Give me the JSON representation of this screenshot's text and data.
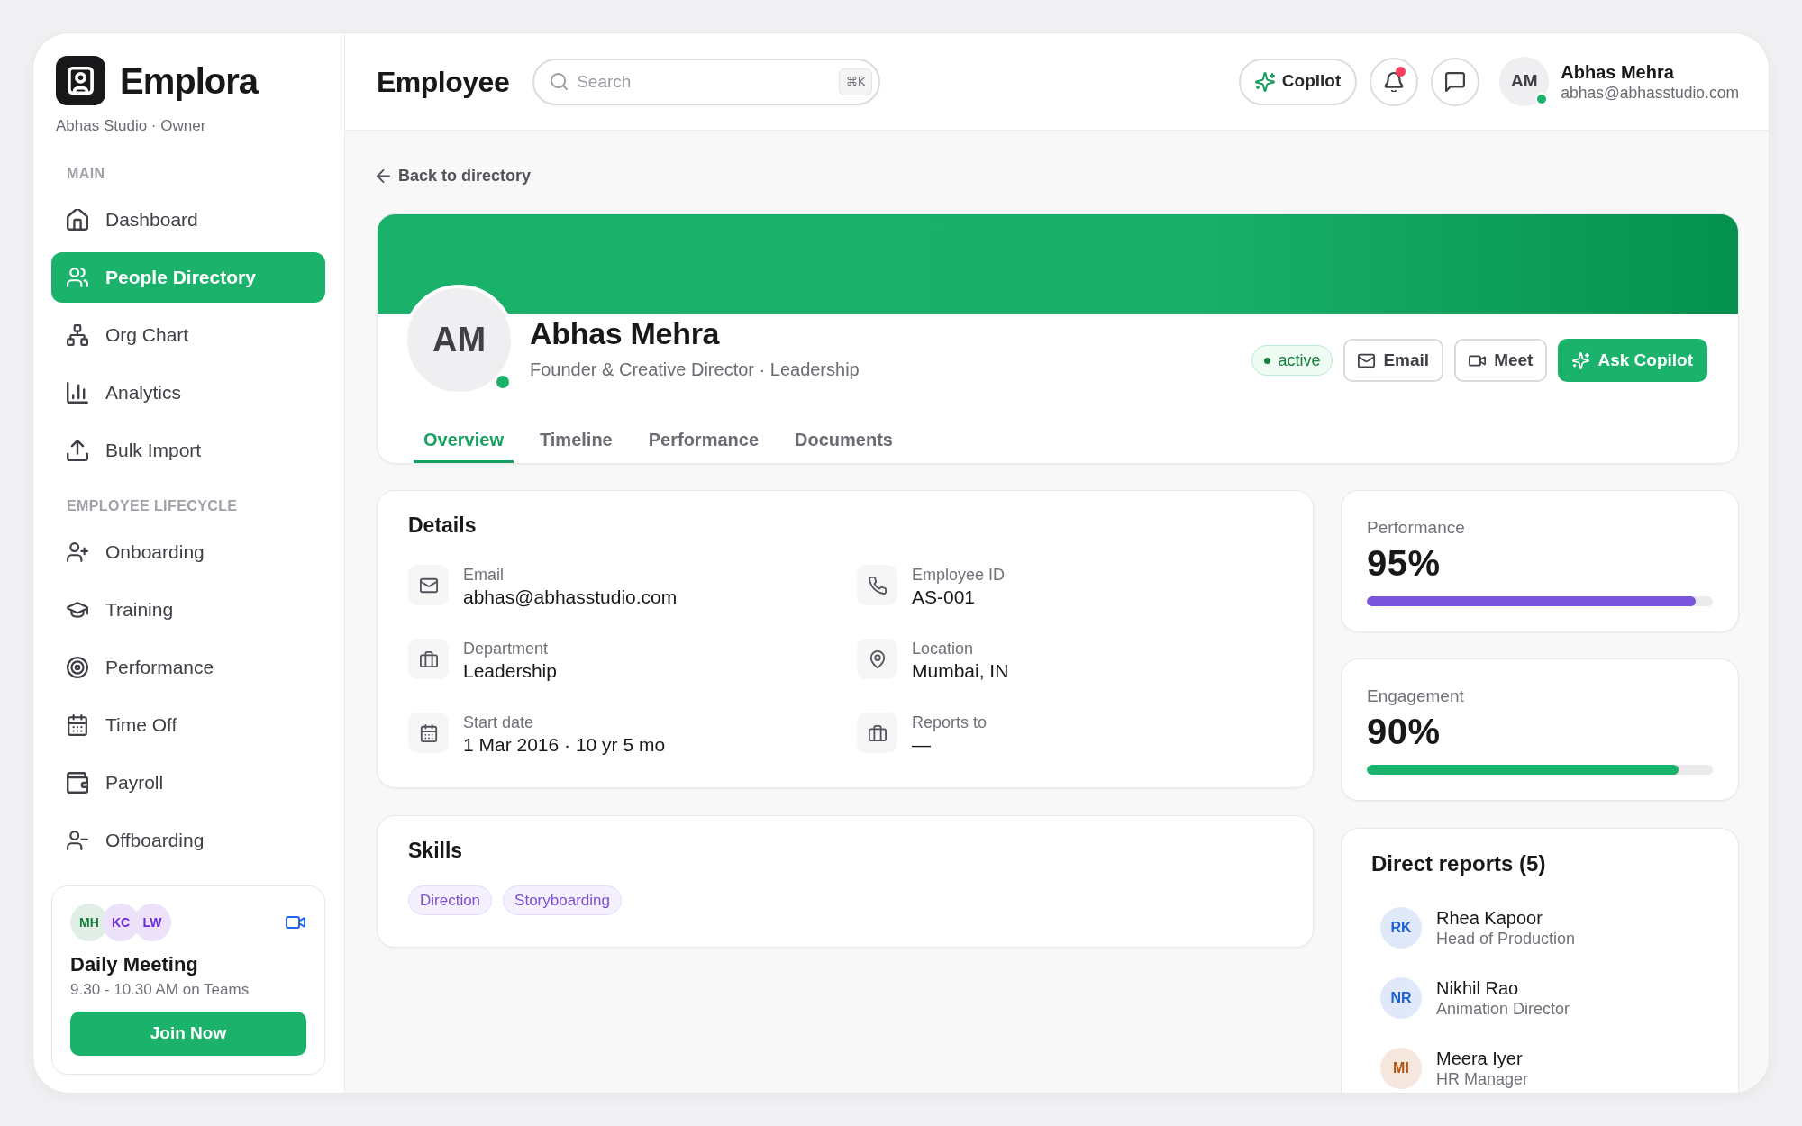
{
  "sidebar": {
    "brand": "Emplora",
    "workspace": "Abhas Studio · Owner",
    "sections": [
      {
        "title": "MAIN",
        "items": [
          {
            "label": "Dashboard",
            "selected": false
          },
          {
            "label": "People Directory",
            "selected": true
          },
          {
            "label": "Org Chart",
            "selected": false
          },
          {
            "label": "Analytics",
            "selected": false
          },
          {
            "label": "Bulk Import",
            "selected": false
          }
        ]
      },
      {
        "title": "EMPLOYEE LIFECYCLE",
        "items": [
          {
            "label": "Onboarding",
            "selected": false
          },
          {
            "label": "Training",
            "selected": false
          },
          {
            "label": "Performance",
            "selected": false
          },
          {
            "label": "Time Off",
            "selected": false
          },
          {
            "label": "Payroll",
            "selected": false
          },
          {
            "label": "Offboarding",
            "selected": false
          }
        ]
      }
    ],
    "meeting": {
      "attendees": [
        {
          "initials": "MH",
          "color": "#15803d"
        },
        {
          "initials": "KC",
          "color": "#6d28d9"
        },
        {
          "initials": "LW",
          "color": "#6d28d9"
        }
      ],
      "title": "Daily Meeting",
      "time": "9.30 - 10.30 AM on Teams",
      "button": "Join Now"
    }
  },
  "header": {
    "title": "Employee",
    "search": {
      "placeholder": "Search",
      "shortcut": "⌘K"
    },
    "copilot_button": "Copilot",
    "notifications": {
      "unread": true
    },
    "user": {
      "initials": "AM",
      "name": "Abhas Mehra",
      "email": "abhas@abhasstudio.com",
      "online": true
    }
  },
  "back_link": "Back to directory",
  "profile": {
    "initials": "AM",
    "online": true,
    "name": "Abhas Mehra",
    "subtitle": "Founder & Creative Director · Leadership",
    "status": "active",
    "actions": [
      {
        "label": "Email",
        "kind": "outline"
      },
      {
        "label": "Meet",
        "kind": "outline"
      },
      {
        "label": "Ask Copilot",
        "kind": "primary"
      }
    ],
    "tabs": [
      {
        "label": "Overview",
        "selected": true
      },
      {
        "label": "Timeline",
        "selected": false
      },
      {
        "label": "Performance",
        "selected": false
      },
      {
        "label": "Documents",
        "selected": false
      }
    ]
  },
  "details": {
    "title": "Details",
    "fields": [
      {
        "label": "Email",
        "value": "abhas@abhasstudio.com"
      },
      {
        "label": "Employee ID",
        "value": "AS-001"
      },
      {
        "label": "Department",
        "value": "Leadership"
      },
      {
        "label": "Location",
        "value": "Mumbai, IN"
      },
      {
        "label": "Start date",
        "value": "1 Mar 2016 · 10 yr 5 mo"
      },
      {
        "label": "Reports to",
        "value": "—"
      }
    ]
  },
  "skills": {
    "title": "Skills",
    "tags": [
      "Direction",
      "Storyboarding"
    ]
  },
  "metrics": [
    {
      "label": "Performance",
      "value": "95%",
      "level": 0.95,
      "color": "#7b55db"
    },
    {
      "label": "Engagement",
      "value": "90%",
      "level": 0.9,
      "color": "#1bb26b"
    }
  ],
  "direct_reports": {
    "title": "Direct reports (5)",
    "people": [
      {
        "initials": "RK",
        "name": "Rhea Kapoor",
        "role": "Head of Production",
        "color": "#1d5fd1"
      },
      {
        "initials": "NR",
        "name": "Nikhil Rao",
        "role": "Animation Director",
        "color": "#1d5fd1"
      },
      {
        "initials": "MI",
        "name": "Meera Iyer",
        "role": "HR Manager",
        "color": "#b45309"
      }
    ]
  }
}
